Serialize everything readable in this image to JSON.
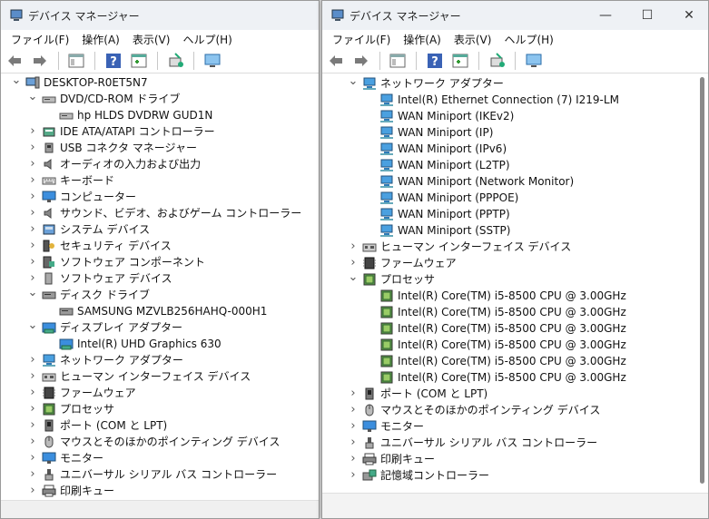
{
  "left_window": {
    "title": "デバイス マネージャー",
    "menu": [
      "ファイル(F)",
      "操作(A)",
      "表示(V)",
      "ヘルプ(H)"
    ],
    "tree": [
      {
        "depth": 0,
        "expander": "open",
        "icon": "computer-icon",
        "label": "DESKTOP-R0ET5N7"
      },
      {
        "depth": 1,
        "expander": "open",
        "icon": "dvd-drive-icon",
        "label": "DVD/CD-ROM ドライブ"
      },
      {
        "depth": 2,
        "expander": "none",
        "icon": "dvd-drive-icon",
        "label": "hp HLDS DVDRW  GUD1N"
      },
      {
        "depth": 1,
        "expander": "closed",
        "icon": "ide-controller-icon",
        "label": "IDE ATA/ATAPI コントローラー"
      },
      {
        "depth": 1,
        "expander": "closed",
        "icon": "usb-connector-icon",
        "label": "USB コネクタ マネージャー"
      },
      {
        "depth": 1,
        "expander": "closed",
        "icon": "speaker-icon",
        "label": "オーディオの入力および出力"
      },
      {
        "depth": 1,
        "expander": "closed",
        "icon": "keyboard-icon",
        "label": "キーボード"
      },
      {
        "depth": 1,
        "expander": "closed",
        "icon": "monitor-icon",
        "label": "コンピューター"
      },
      {
        "depth": 1,
        "expander": "closed",
        "icon": "speaker-icon",
        "label": "サウンド、ビデオ、およびゲーム コントローラー"
      },
      {
        "depth": 1,
        "expander": "closed",
        "icon": "system-device-icon",
        "label": "システム デバイス"
      },
      {
        "depth": 1,
        "expander": "closed",
        "icon": "security-key-icon",
        "label": "セキュリティ デバイス"
      },
      {
        "depth": 1,
        "expander": "closed",
        "icon": "software-component-icon",
        "label": "ソフトウェア コンポーネント"
      },
      {
        "depth": 1,
        "expander": "closed",
        "icon": "software-device-icon",
        "label": "ソフトウェア デバイス"
      },
      {
        "depth": 1,
        "expander": "open",
        "icon": "disk-drive-icon",
        "label": "ディスク ドライブ"
      },
      {
        "depth": 2,
        "expander": "none",
        "icon": "disk-drive-icon",
        "label": "SAMSUNG MZVLB256HAHQ-000H1"
      },
      {
        "depth": 1,
        "expander": "open",
        "icon": "display-adapter-icon",
        "label": "ディスプレイ アダプター"
      },
      {
        "depth": 2,
        "expander": "none",
        "icon": "display-adapter-icon",
        "label": "Intel(R) UHD Graphics 630"
      },
      {
        "depth": 1,
        "expander": "closed",
        "icon": "network-adapter-icon",
        "label": "ネットワーク アダプター"
      },
      {
        "depth": 1,
        "expander": "closed",
        "icon": "hid-icon",
        "label": "ヒューマン インターフェイス デバイス"
      },
      {
        "depth": 1,
        "expander": "closed",
        "icon": "firmware-icon",
        "label": "ファームウェア"
      },
      {
        "depth": 1,
        "expander": "closed",
        "icon": "processor-icon",
        "label": "プロセッサ"
      },
      {
        "depth": 1,
        "expander": "closed",
        "icon": "port-icon",
        "label": "ポート (COM と LPT)"
      },
      {
        "depth": 1,
        "expander": "closed",
        "icon": "mouse-icon",
        "label": "マウスとそのほかのポインティング デバイス"
      },
      {
        "depth": 1,
        "expander": "closed",
        "icon": "monitor-icon",
        "label": "モニター"
      },
      {
        "depth": 1,
        "expander": "closed",
        "icon": "usb-icon",
        "label": "ユニバーサル シリアル バス コントローラー"
      },
      {
        "depth": 1,
        "expander": "closed",
        "icon": "printer-icon",
        "label": "印刷キュー"
      }
    ]
  },
  "right_window": {
    "title": "デバイス マネージャー",
    "controls": {
      "minimize": "—",
      "maximize": "☐",
      "close": "✕"
    },
    "menu": [
      "ファイル(F)",
      "操作(A)",
      "表示(V)",
      "ヘルプ(H)"
    ],
    "tree": [
      {
        "depth": 1,
        "expander": "open",
        "icon": "network-adapter-icon",
        "label": "ネットワーク アダプター"
      },
      {
        "depth": 2,
        "expander": "none",
        "icon": "network-adapter-icon",
        "label": "Intel(R) Ethernet Connection (7) I219-LM"
      },
      {
        "depth": 2,
        "expander": "none",
        "icon": "network-adapter-icon",
        "label": "WAN Miniport (IKEv2)"
      },
      {
        "depth": 2,
        "expander": "none",
        "icon": "network-adapter-icon",
        "label": "WAN Miniport (IP)"
      },
      {
        "depth": 2,
        "expander": "none",
        "icon": "network-adapter-icon",
        "label": "WAN Miniport (IPv6)"
      },
      {
        "depth": 2,
        "expander": "none",
        "icon": "network-adapter-icon",
        "label": "WAN Miniport (L2TP)"
      },
      {
        "depth": 2,
        "expander": "none",
        "icon": "network-adapter-icon",
        "label": "WAN Miniport (Network Monitor)"
      },
      {
        "depth": 2,
        "expander": "none",
        "icon": "network-adapter-icon",
        "label": "WAN Miniport (PPPOE)"
      },
      {
        "depth": 2,
        "expander": "none",
        "icon": "network-adapter-icon",
        "label": "WAN Miniport (PPTP)"
      },
      {
        "depth": 2,
        "expander": "none",
        "icon": "network-adapter-icon",
        "label": "WAN Miniport (SSTP)"
      },
      {
        "depth": 1,
        "expander": "closed",
        "icon": "hid-icon",
        "label": "ヒューマン インターフェイス デバイス"
      },
      {
        "depth": 1,
        "expander": "closed",
        "icon": "firmware-icon",
        "label": "ファームウェア"
      },
      {
        "depth": 1,
        "expander": "open",
        "icon": "processor-icon",
        "label": "プロセッサ"
      },
      {
        "depth": 2,
        "expander": "none",
        "icon": "processor-icon",
        "label": "Intel(R) Core(TM) i5-8500 CPU @ 3.00GHz"
      },
      {
        "depth": 2,
        "expander": "none",
        "icon": "processor-icon",
        "label": "Intel(R) Core(TM) i5-8500 CPU @ 3.00GHz"
      },
      {
        "depth": 2,
        "expander": "none",
        "icon": "processor-icon",
        "label": "Intel(R) Core(TM) i5-8500 CPU @ 3.00GHz"
      },
      {
        "depth": 2,
        "expander": "none",
        "icon": "processor-icon",
        "label": "Intel(R) Core(TM) i5-8500 CPU @ 3.00GHz"
      },
      {
        "depth": 2,
        "expander": "none",
        "icon": "processor-icon",
        "label": "Intel(R) Core(TM) i5-8500 CPU @ 3.00GHz"
      },
      {
        "depth": 2,
        "expander": "none",
        "icon": "processor-icon",
        "label": "Intel(R) Core(TM) i5-8500 CPU @ 3.00GHz"
      },
      {
        "depth": 1,
        "expander": "closed",
        "icon": "port-icon",
        "label": "ポート (COM と LPT)"
      },
      {
        "depth": 1,
        "expander": "closed",
        "icon": "mouse-icon",
        "label": "マウスとそのほかのポインティング デバイス"
      },
      {
        "depth": 1,
        "expander": "closed",
        "icon": "monitor-icon",
        "label": "モニター"
      },
      {
        "depth": 1,
        "expander": "closed",
        "icon": "usb-icon",
        "label": "ユニバーサル シリアル バス コントローラー"
      },
      {
        "depth": 1,
        "expander": "closed",
        "icon": "printer-icon",
        "label": "印刷キュー"
      },
      {
        "depth": 1,
        "expander": "closed",
        "icon": "storage-controller-icon",
        "label": "記憶域コントローラー"
      }
    ]
  },
  "toolbar_icons": [
    "back-arrow-icon",
    "forward-arrow-icon",
    "properties-icon",
    "help-icon",
    "show-hide-console-tree-icon",
    "update-driver-icon",
    "scan-hardware-icon"
  ],
  "colors": {
    "accent": "#1f74c7",
    "titlebar": "#eef1f5",
    "selection": "#cce4f7"
  }
}
